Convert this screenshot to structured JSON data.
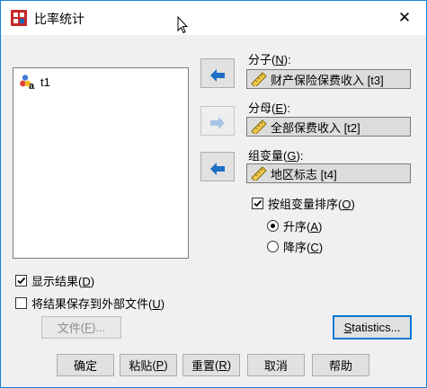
{
  "window": {
    "title": "比率统计",
    "close_glyph": "✕"
  },
  "source_list": {
    "items": [
      {
        "label": "t1",
        "icon": "nominal-variable-icon"
      }
    ]
  },
  "numerator": {
    "label": "分子",
    "mnemonic": "N",
    "value": "财产保险保费收入 [t3]",
    "move_button_icon": "arrow-left-icon"
  },
  "denominator": {
    "label": "分母",
    "mnemonic": "E",
    "value": "全部保费收入 [t2]",
    "move_button_icon": "arrow-right-icon"
  },
  "group_variable": {
    "label": "组变量",
    "mnemonic": "G",
    "value": "地区标志 [t4]",
    "move_button_icon": "arrow-left-icon"
  },
  "sort_option": {
    "label": "按组变量排序",
    "mnemonic": "O",
    "checked": true
  },
  "order": {
    "ascending": {
      "label": "升序",
      "mnemonic": "A",
      "selected": true
    },
    "descending": {
      "label": "降序",
      "mnemonic": "C",
      "selected": false
    }
  },
  "display_results": {
    "label": "显示结果",
    "mnemonic": "D",
    "checked": true
  },
  "save_results": {
    "label": "将结果保存到外部文件",
    "mnemonic": "U",
    "checked": false
  },
  "file_button": {
    "label": "文件",
    "mnemonic": "F",
    "suffix": "..."
  },
  "statistics_button": {
    "label": "tatistics...",
    "mnemonic": "S"
  },
  "buttons": {
    "ok": "确定",
    "paste": {
      "label": "粘贴",
      "mnemonic": "P"
    },
    "reset": {
      "label": "重置",
      "mnemonic": "R"
    },
    "cancel": "取消",
    "help": "帮助"
  },
  "colors": {
    "accent": "#0078d7",
    "arrow_active": "#1e6fc7",
    "arrow_disabled": "#a8c4e4",
    "target_bg": "#dcdcdc"
  }
}
